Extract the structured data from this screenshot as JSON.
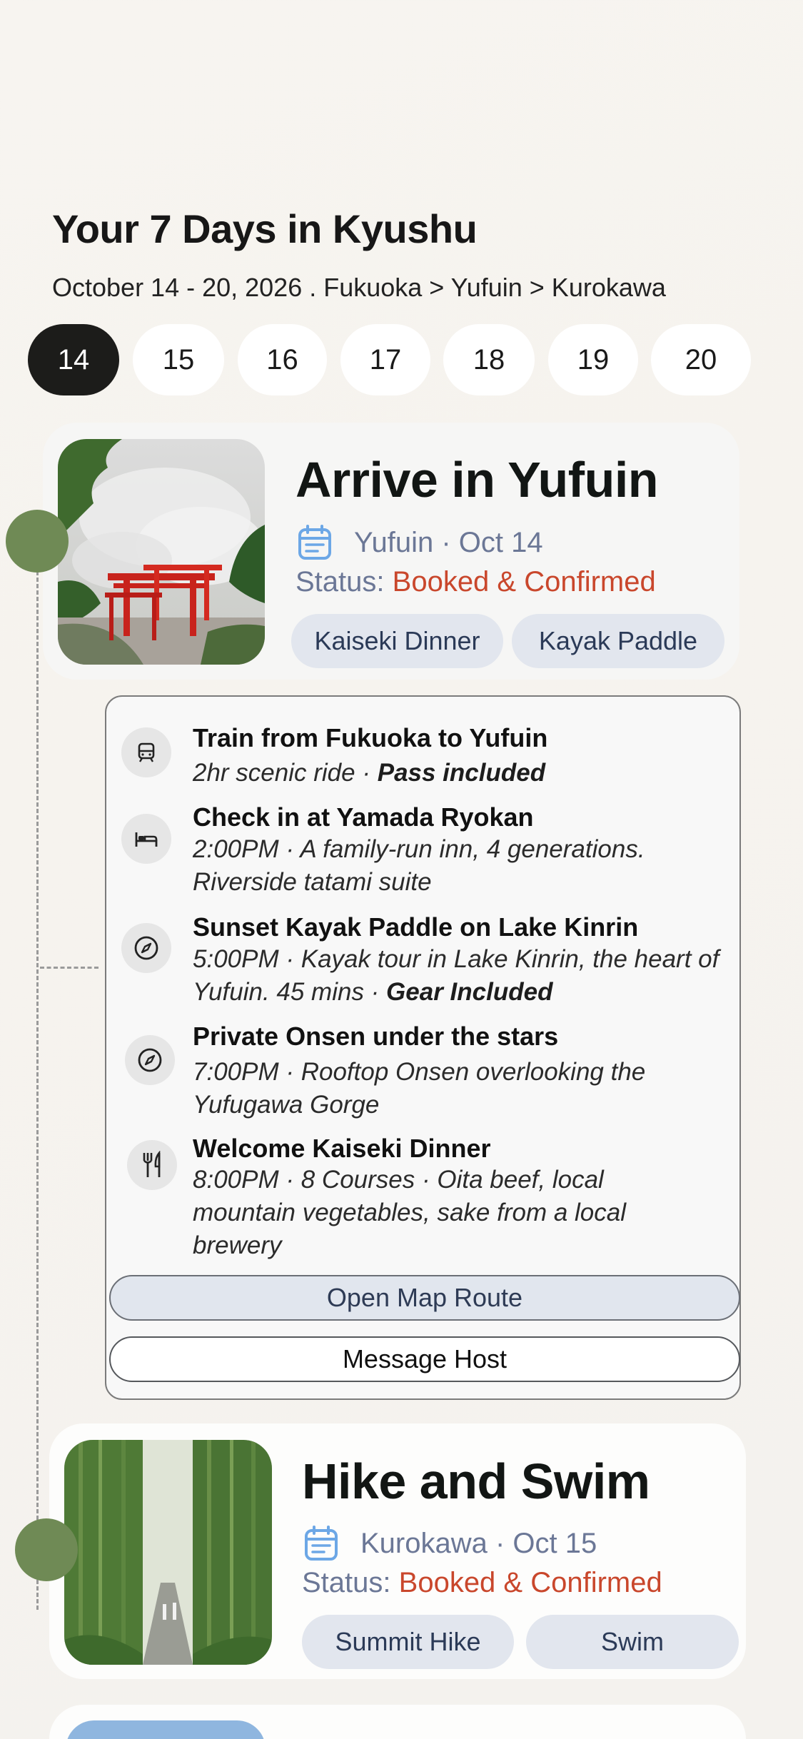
{
  "header": {
    "title": "Your 7 Days in Kyushu",
    "subtitle": "October 14 - 20, 2026 . Fukuoka > Yufuin > Kurokawa"
  },
  "days": [
    "14",
    "15",
    "16",
    "17",
    "18",
    "19",
    "20"
  ],
  "selected_day": "14",
  "cards": [
    {
      "title": "Arrive in Yufuin",
      "location": "Yufuin · Oct 14",
      "status_label": "Status:",
      "status_value": "Booked & Confirmed",
      "tags": [
        "Kaiseki Dinner",
        "Kayak Paddle"
      ],
      "image": "torii-gate-steam-photo"
    },
    {
      "title": "Hike and Swim",
      "location": "Kurokawa · Oct 15",
      "status_label": "Status:",
      "status_value": "Booked & Confirmed",
      "tags": [
        "Summit Hike",
        "Swim"
      ],
      "image": "bamboo-forest-path-photo"
    }
  ],
  "itinerary": [
    {
      "icon": "train-icon",
      "title": "Train from Fukuoka to Yufuin",
      "desc": "2hr scenic ride · ",
      "desc_bold": "Pass included"
    },
    {
      "icon": "bed-icon",
      "title": "Check in at Yamada Ryokan",
      "desc": "2:00PM · A family-run inn, 4 generations. Riverside tatami suite",
      "desc_bold": ""
    },
    {
      "icon": "compass-icon",
      "title": "Sunset Kayak Paddle on Lake Kinrin",
      "desc": "5:00PM · Kayak tour in Lake Kinrin, the heart of Yufuin. 45 mins · ",
      "desc_bold": "Gear Included"
    },
    {
      "icon": "compass-icon",
      "title": "Private Onsen under the stars",
      "desc": " 7:00PM ·  Rooftop Onsen overlooking the Yufugawa Gorge",
      "desc_bold": ""
    },
    {
      "icon": "utensils-icon",
      "title": "Welcome Kaiseki Dinner",
      "desc": "8:00PM · 8 Courses · Oita beef, local mountain vegetables, sake from a local brewery",
      "desc_bold": ""
    }
  ],
  "buttons": {
    "map": "Open Map Route",
    "message": "Message Host"
  },
  "colors": {
    "accent_green": "#6f8a55",
    "status_red": "#c9472c",
    "muted_blue": "#6b7796",
    "tag_bg": "#e2e6ee"
  }
}
